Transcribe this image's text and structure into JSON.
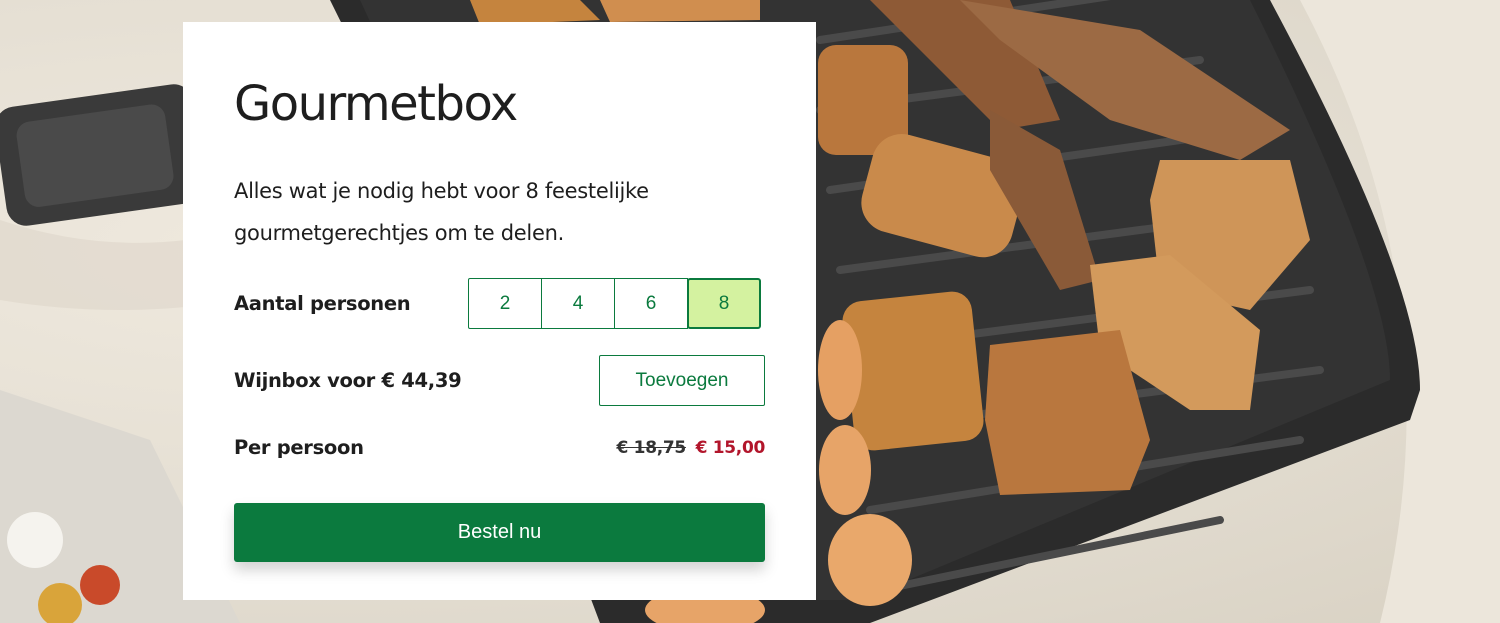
{
  "product": {
    "title": "Gourmetbox",
    "description": "Alles wat je nodig hebt voor 8 feestelijke gourmetgerechtjes om te delen."
  },
  "persons": {
    "label": "Aantal personen",
    "options": [
      "2",
      "4",
      "6",
      "8"
    ],
    "selected": "8"
  },
  "wine": {
    "label": "Wijnbox voor € 44,39",
    "button_label": "Toevoegen"
  },
  "price": {
    "label": "Per persoon",
    "old": "€ 18,75",
    "new": "€ 15,00"
  },
  "order": {
    "button_label": "Bestel nu"
  },
  "colors": {
    "accent": "#0b7a3e",
    "selected_bg": "#d4f2a0",
    "sale_price": "#b2152b"
  }
}
